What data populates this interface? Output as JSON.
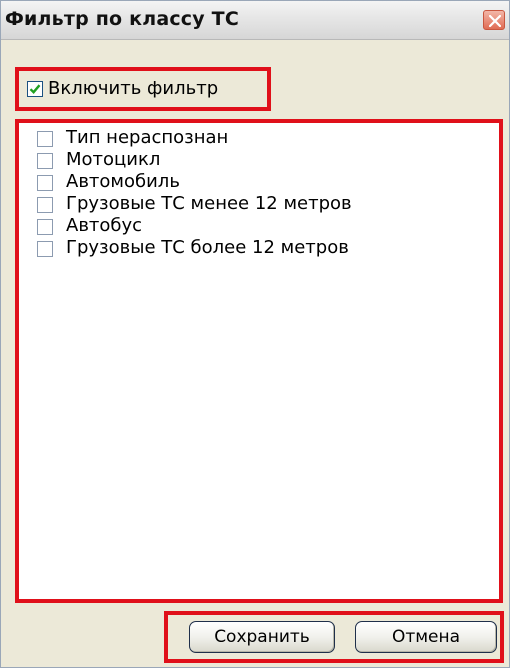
{
  "window": {
    "title": "Фильтр по классу ТС"
  },
  "filter": {
    "enable_label": "Включить фильтр",
    "enabled": true
  },
  "list": {
    "items": [
      {
        "label": "Тип нераспознан",
        "checked": false
      },
      {
        "label": "Мотоцикл",
        "checked": false
      },
      {
        "label": "Автомобиль",
        "checked": false
      },
      {
        "label": "Грузовые ТС менее 12 метров",
        "checked": false
      },
      {
        "label": "Автобус",
        "checked": false
      },
      {
        "label": "Грузовые ТС более 12 метров",
        "checked": false
      }
    ]
  },
  "buttons": {
    "save_label": "Сохранить",
    "cancel_label": "Отмена"
  },
  "colors": {
    "highlight_frame": "#e0101a",
    "window_background": "#ece9d8",
    "check_mark": "#21a121"
  },
  "icons": {
    "close": "close-icon",
    "check": "checkmark-icon"
  }
}
